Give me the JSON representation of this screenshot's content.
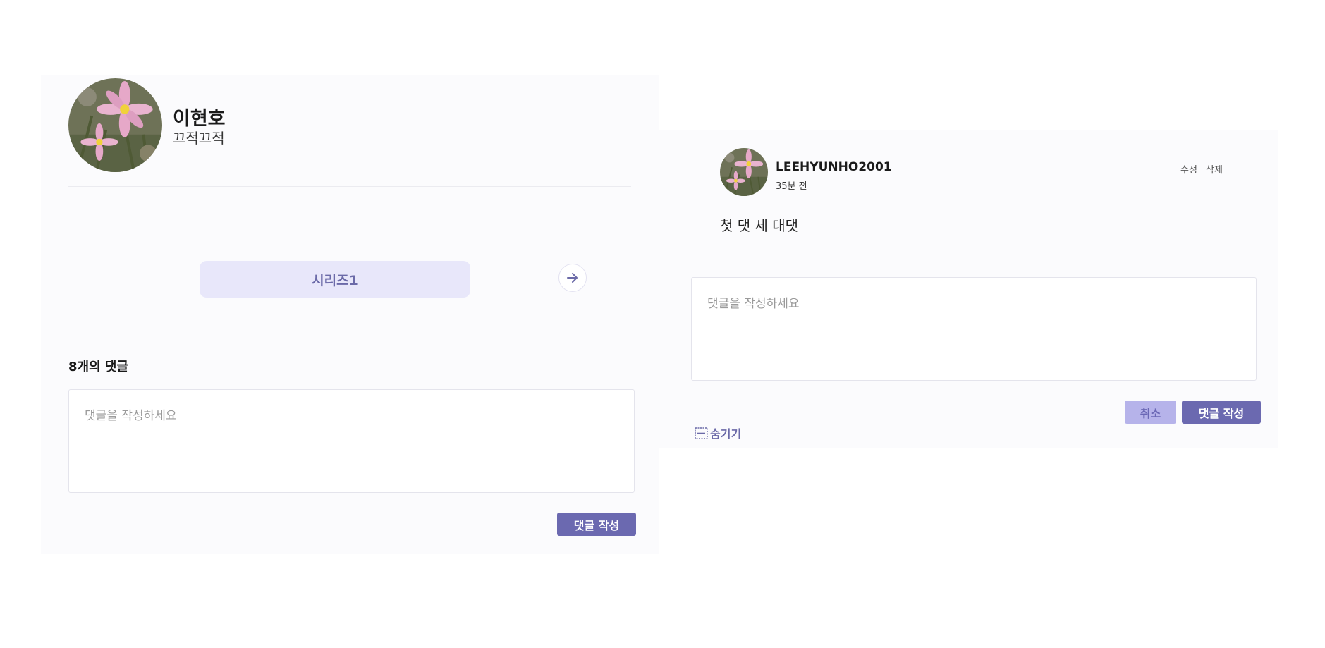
{
  "profile": {
    "name": "이현호",
    "bio": "끄적끄적",
    "avatar_icon": "flower-photo"
  },
  "series": {
    "label": "시리즈1",
    "next_icon": "arrow-right-icon"
  },
  "comments_section": {
    "count_label": "8개의 댓글",
    "input_placeholder": "댓글을 작성하세요",
    "submit_label": "댓글 작성"
  },
  "reply_thread": {
    "comment": {
      "author": "LEEHYUNHO2001",
      "time": "35분 전",
      "edit_label": "수정",
      "delete_label": "삭제",
      "text": "첫 댓 세 대댓",
      "avatar_icon": "flower-photo"
    },
    "reply_input_placeholder": "댓글을 작성하세요",
    "cancel_label": "취소",
    "submit_label": "댓글 작성",
    "hide_label": "숨기기",
    "hide_icon": "collapse-box-icon"
  },
  "colors": {
    "accent": "#6b69b0",
    "accent_light": "#b6b3ea",
    "pill_bg": "#e8e7fa",
    "panel_bg": "#fbfbfd"
  }
}
